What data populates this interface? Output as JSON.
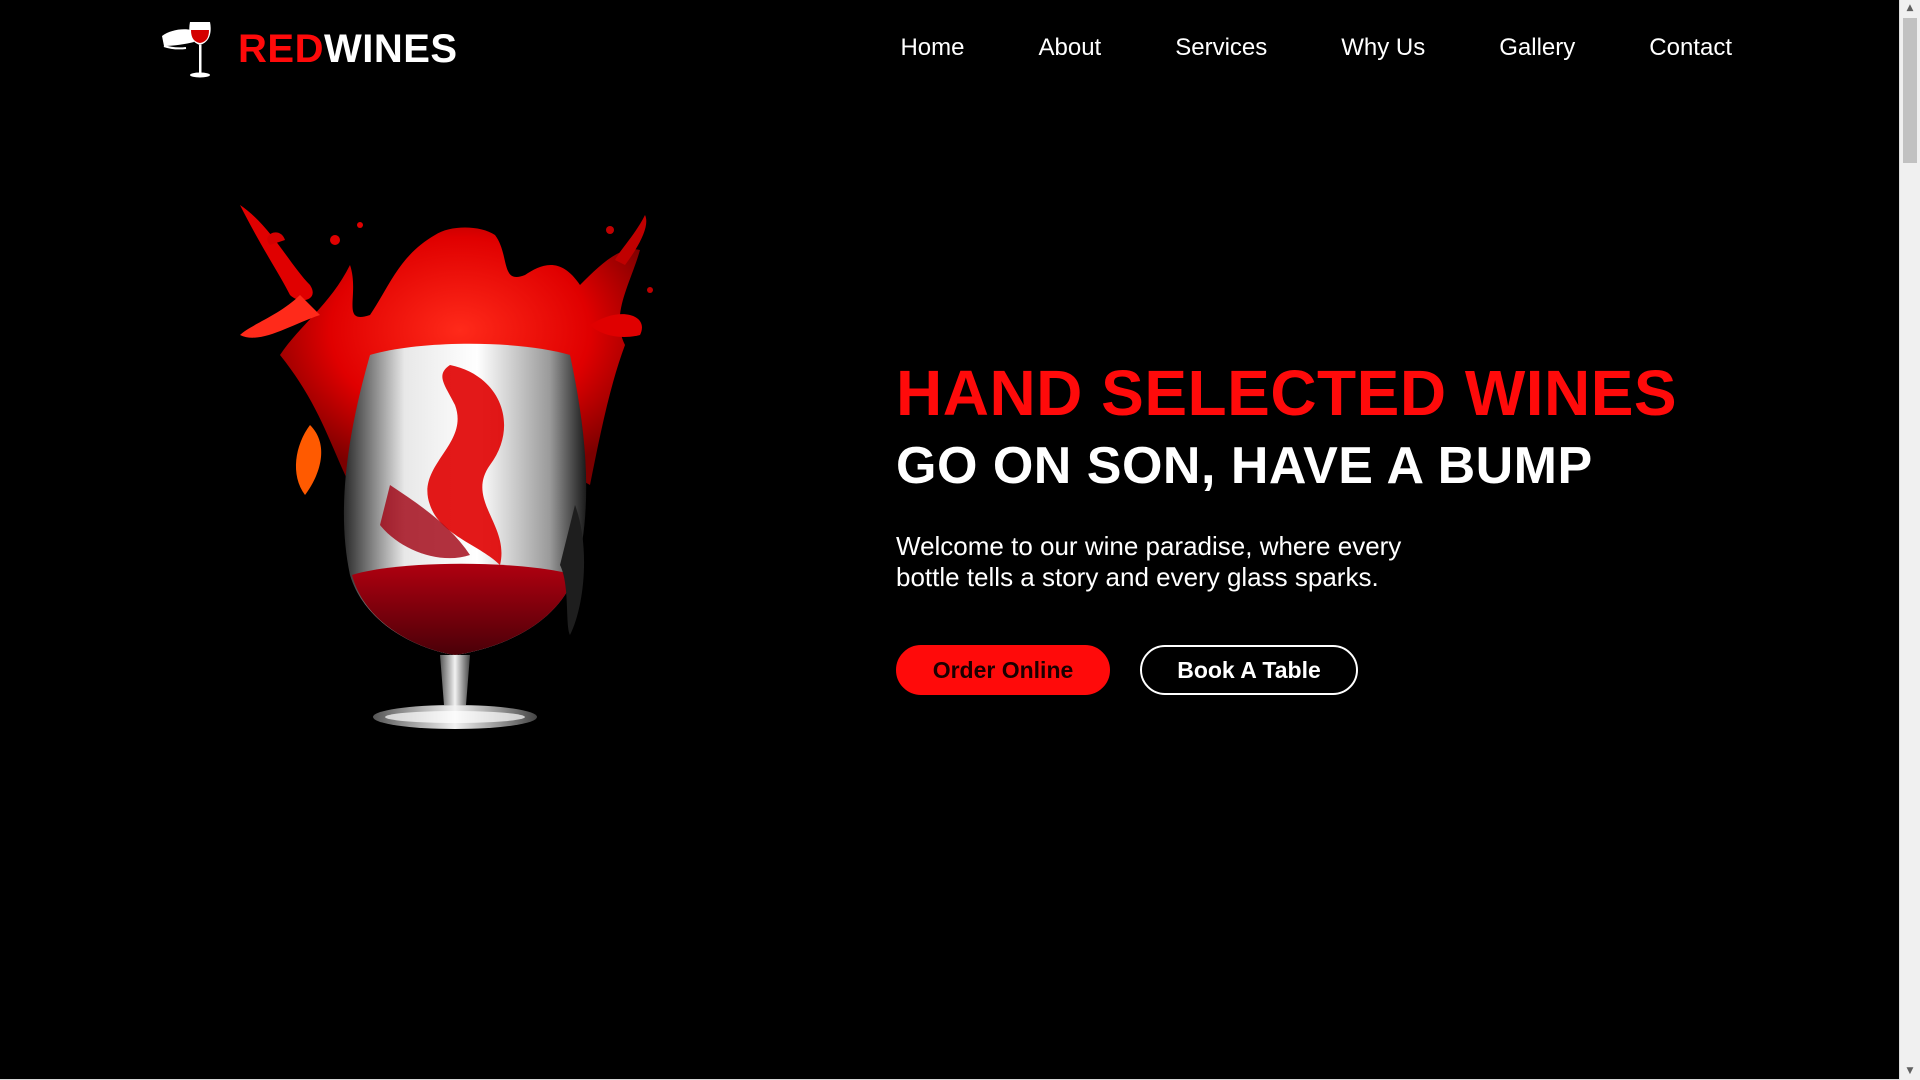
{
  "brand": {
    "name_part_1": "RED",
    "name_part_2": "WINES",
    "icon": "wine-glass-in-hand-icon",
    "accent_color": "#ff0a0a"
  },
  "nav": {
    "items": [
      {
        "label": "Home"
      },
      {
        "label": "About"
      },
      {
        "label": "Services"
      },
      {
        "label": "Why Us"
      },
      {
        "label": "Gallery"
      },
      {
        "label": "Contact"
      }
    ]
  },
  "hero": {
    "headline": "HAND SELECTED WINES",
    "subheadline": "GO ON SON, HAVE A BUMP",
    "tagline_line_1": "Welcome to our wine paradise, where every",
    "tagline_line_2": "bottle tells a story and every glass sparks.",
    "primary_button": "Order Online",
    "secondary_button": "Book A Table",
    "image": "red-wine-splash-glass-image"
  },
  "scrollbar": {
    "up_glyph": "▲",
    "down_glyph": "▼"
  }
}
